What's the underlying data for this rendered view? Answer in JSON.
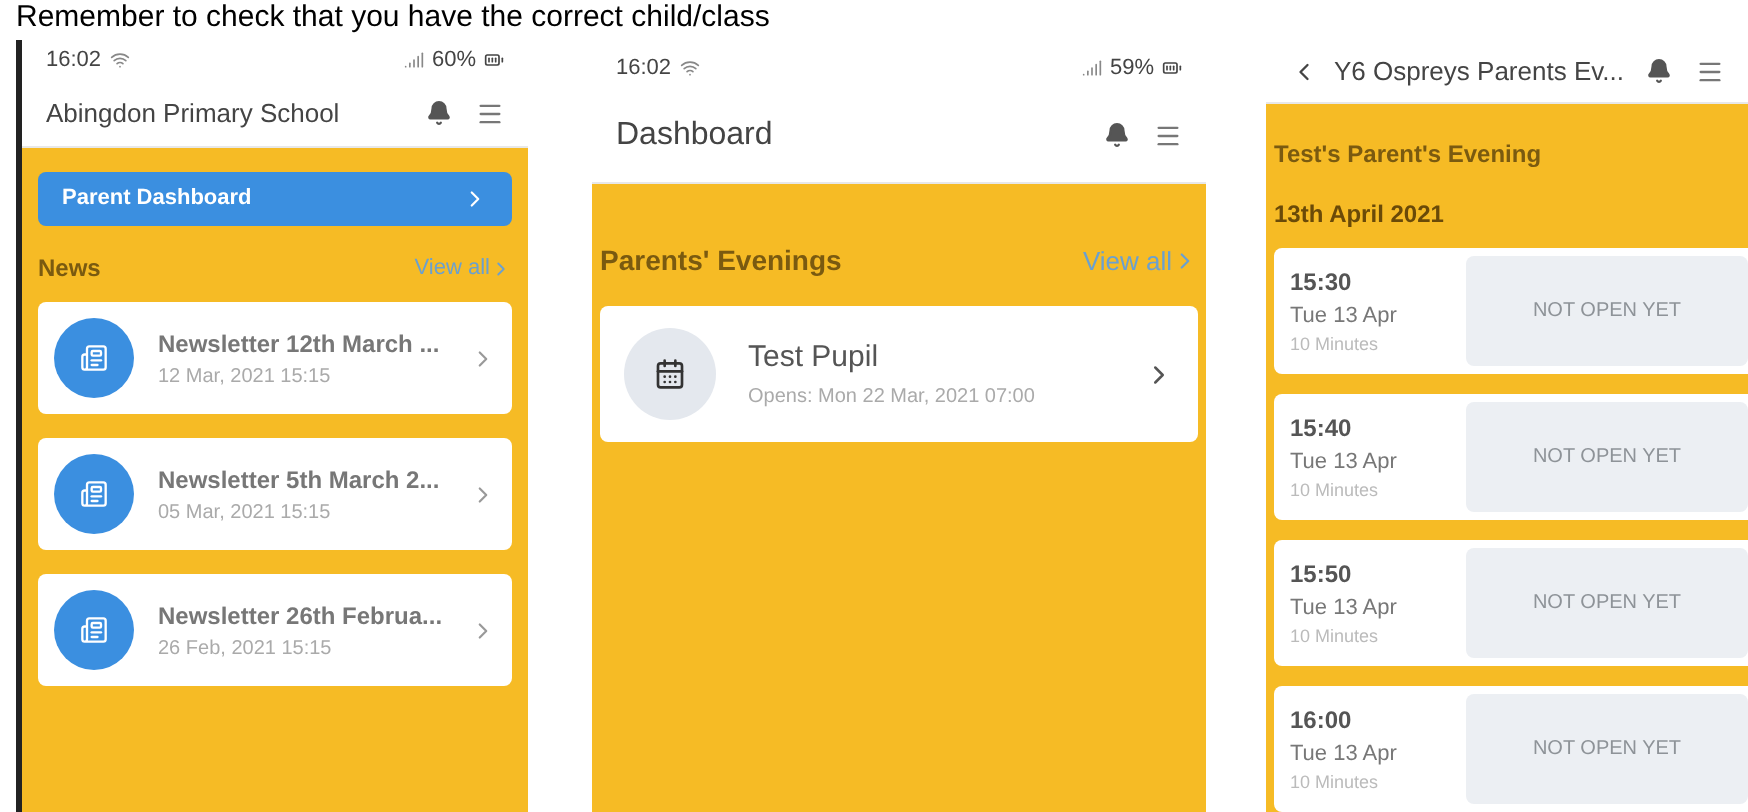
{
  "caption": "Remember to check that you have the correct child/class",
  "home_screen": {
    "status_bar": {
      "time": "16:02",
      "battery": "60%"
    },
    "header": {
      "title": "Abingdon Primary School"
    },
    "dashboard_button": {
      "label": "Parent Dashboard"
    },
    "news": {
      "title": "News",
      "view_all": "View all",
      "items": [
        {
          "title": "Newsletter 12th March ...",
          "date": "12 Mar, 2021 15:15"
        },
        {
          "title": "Newsletter 5th March 2...",
          "date": "05 Mar, 2021 15:15"
        },
        {
          "title": "Newsletter 26th Februa...",
          "date": "26 Feb, 2021 15:15"
        }
      ]
    }
  },
  "dashboard_screen": {
    "status_bar": {
      "time": "16:02",
      "battery": "59%"
    },
    "header": {
      "title": "Dashboard"
    },
    "parents_evenings": {
      "title": "Parents' Evenings",
      "view_all": "View all",
      "items": [
        {
          "name": "Test Pupil",
          "opens": "Opens: Mon 22 Mar, 2021 07:00"
        }
      ]
    }
  },
  "evening_screen": {
    "header": {
      "title": "Y6 Ospreys Parents Ev..."
    },
    "title": "Test's Parent's Evening",
    "date": "13th April 2021",
    "slots": [
      {
        "time": "15:30",
        "day": "Tue 13 Apr",
        "duration": "10 Minutes",
        "status": "NOT OPEN YET"
      },
      {
        "time": "15:40",
        "day": "Tue 13 Apr",
        "duration": "10 Minutes",
        "status": "NOT OPEN YET"
      },
      {
        "time": "15:50",
        "day": "Tue 13 Apr",
        "duration": "10 Minutes",
        "status": "NOT OPEN YET"
      },
      {
        "time": "16:00",
        "day": "Tue 13 Apr",
        "duration": "10 Minutes",
        "status": "NOT OPEN YET"
      }
    ]
  }
}
